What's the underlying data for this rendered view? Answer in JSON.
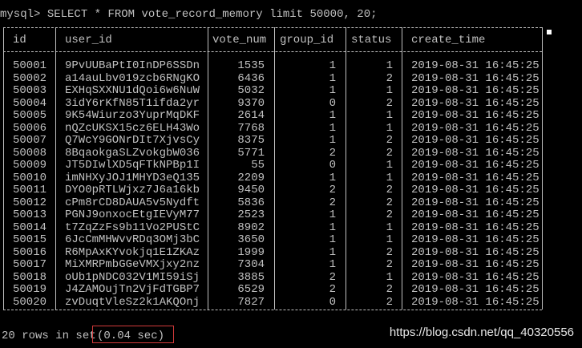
{
  "prompt": "mysql>",
  "query": "SELECT * FROM vote_record_memory limit 50000, 20;",
  "columns": [
    "id",
    "user_id",
    "vote_num",
    "group_id",
    "status",
    "create_time"
  ],
  "rows": [
    [
      "50001",
      "9PvUUBaPtI0InDP6SSDn",
      "1535",
      "1",
      "1",
      "2019-08-31 16:45:25"
    ],
    [
      "50002",
      "a14auLbv019zcb6RNgKO",
      "6436",
      "1",
      "2",
      "2019-08-31 16:45:25"
    ],
    [
      "50003",
      "EXHqSXXNU1dQoi6w6NuW",
      "5032",
      "1",
      "1",
      "2019-08-31 16:45:25"
    ],
    [
      "50004",
      "3idY6rKfN85T1ifda2yr",
      "9370",
      "0",
      "2",
      "2019-08-31 16:45:25"
    ],
    [
      "50005",
      "9K54Wiurzo3YuprMqDKF",
      "2614",
      "1",
      "1",
      "2019-08-31 16:45:25"
    ],
    [
      "50006",
      "nQZcUKSX15cz6ELH43Wo",
      "7768",
      "1",
      "1",
      "2019-08-31 16:45:25"
    ],
    [
      "50007",
      "Q7WcY9GONrDIt7XjvsCy",
      "8375",
      "1",
      "2",
      "2019-08-31 16:45:25"
    ],
    [
      "50008",
      "8BqaokgaSLZvokgbW036",
      "5771",
      "2",
      "2",
      "2019-08-31 16:45:25"
    ],
    [
      "50009",
      "JT5DIwlXD5qFTkNPBp1I",
      "55",
      "0",
      "1",
      "2019-08-31 16:45:25"
    ],
    [
      "50010",
      "imNHXyJOJ1MHYD3eQ135",
      "2209",
      "1",
      "1",
      "2019-08-31 16:45:25"
    ],
    [
      "50011",
      "DYO0pRTLWjxz7J6a16kb",
      "9450",
      "2",
      "2",
      "2019-08-31 16:45:25"
    ],
    [
      "50012",
      "cPm8rCD8DAUA5v5Nydft",
      "5836",
      "2",
      "2",
      "2019-08-31 16:45:25"
    ],
    [
      "50013",
      "PGNJ9onxocEtgIEVyM77",
      "2523",
      "1",
      "2",
      "2019-08-31 16:45:25"
    ],
    [
      "50014",
      "t7ZqZzFs9b11Vo2PUStC",
      "8902",
      "1",
      "1",
      "2019-08-31 16:45:25"
    ],
    [
      "50015",
      "6JcCmMHWvvRDq3OMj3bC",
      "3650",
      "1",
      "1",
      "2019-08-31 16:45:25"
    ],
    [
      "50016",
      "R6MpAxKYvokjq1E1ZKAz",
      "1999",
      "1",
      "2",
      "2019-08-31 16:45:25"
    ],
    [
      "50017",
      "MiXMRPmbGGeVMXjxy2nz",
      "7304",
      "1",
      "2",
      "2019-08-31 16:45:25"
    ],
    [
      "50018",
      "oUb1pNDC032V1MI59iSj",
      "3885",
      "2",
      "1",
      "2019-08-31 16:45:25"
    ],
    [
      "50019",
      "J4ZAMOujTn2VjFdTGBP7",
      "6529",
      "2",
      "2",
      "2019-08-31 16:45:25"
    ],
    [
      "50020",
      "zvDuqtVleSz2k1AKQOnj",
      "7827",
      "0",
      "2",
      "2019-08-31 16:45:25"
    ]
  ],
  "footer": {
    "rows_text": "20 rows in set",
    "timing": "(0.04 sec)"
  },
  "watermark": "https://blog.csdn.net/qq_40320556",
  "colors": {
    "background": "#000000",
    "text": "#c0c0c0",
    "highlight_box": "#d23a3a"
  }
}
